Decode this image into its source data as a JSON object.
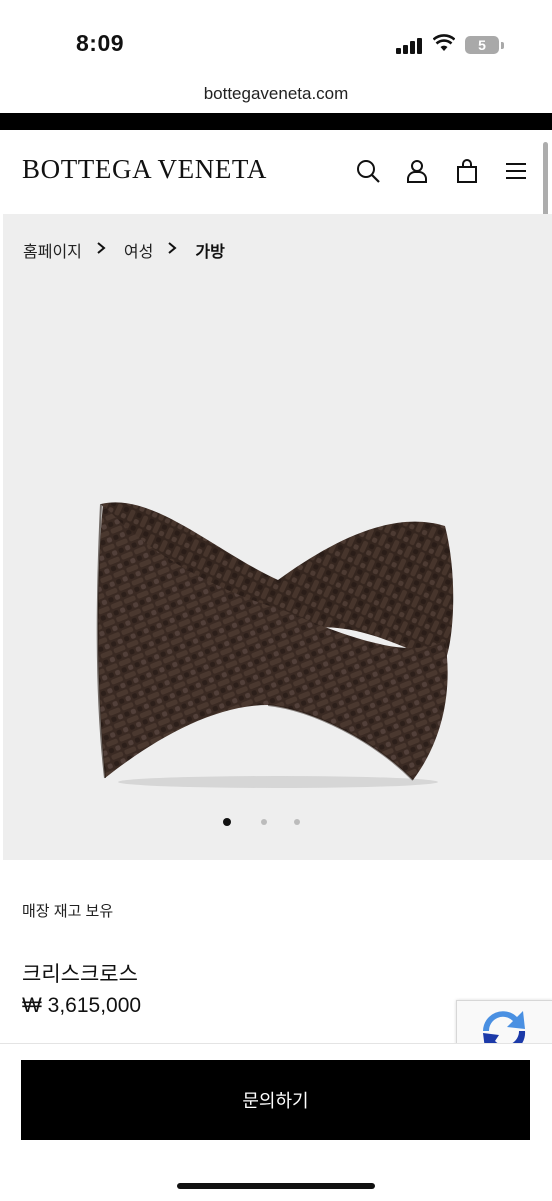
{
  "status_bar": {
    "time": "8:09",
    "battery": "5"
  },
  "browser": {
    "url": "bottegaveneta.com"
  },
  "header": {
    "brand": "BOTTEGA VENETA",
    "icons": [
      "search-icon",
      "account-icon",
      "shopping-bag-icon",
      "menu-icon"
    ]
  },
  "breadcrumb": {
    "home": "홈페이지",
    "women": "여성",
    "bags": "가방"
  },
  "gallery": {
    "slide_count": 3,
    "active_slide": 1
  },
  "product": {
    "availability": "매장 재고 보유",
    "name": "크리스크로스",
    "price": "₩ 3,615,000",
    "color": "#3a2a23"
  },
  "actions": {
    "inquire_label": "문의하기"
  }
}
